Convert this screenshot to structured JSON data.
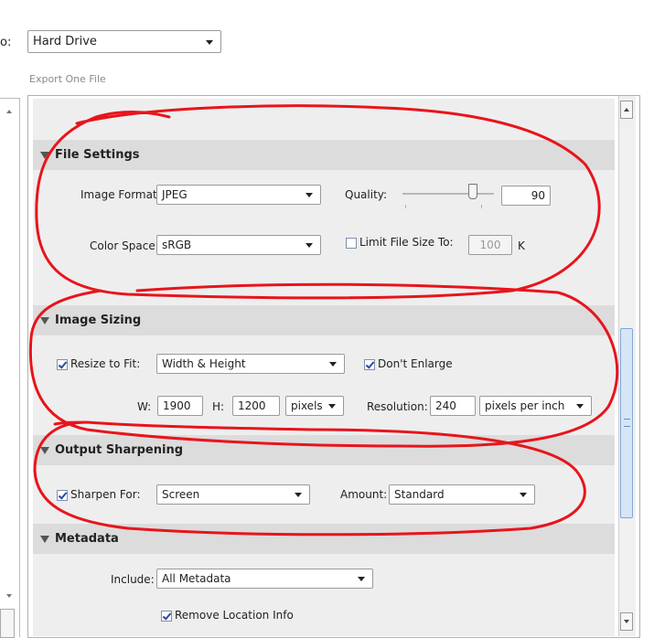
{
  "top": {
    "export_to_label": "o:",
    "destination": "Hard Drive",
    "subtitle": "Export One File"
  },
  "file_settings": {
    "title": "File Settings",
    "image_format_label": "Image Format:",
    "image_format_value": "JPEG",
    "quality_label": "Quality:",
    "quality_value": "90",
    "quality_level": 90,
    "color_space_label": "Color Space:",
    "color_space_value": "sRGB",
    "limit_size_label": "Limit File Size To:",
    "limit_size_value": "100",
    "limit_size_unit": "K",
    "limit_size_checked": false
  },
  "image_sizing": {
    "title": "Image Sizing",
    "resize_label": "Resize to Fit:",
    "resize_checked": true,
    "resize_mode": "Width & Height",
    "dont_enlarge_label": "Don't Enlarge",
    "dont_enlarge_checked": true,
    "w_label": "W:",
    "w_value": "1900",
    "h_label": "H:",
    "h_value": "1200",
    "unit_value": "pixels",
    "resolution_label": "Resolution:",
    "resolution_value": "240",
    "resolution_unit": "pixels per inch"
  },
  "output_sharpening": {
    "title": "Output Sharpening",
    "sharpen_label": "Sharpen For:",
    "sharpen_checked": true,
    "sharpen_value": "Screen",
    "amount_label": "Amount:",
    "amount_value": "Standard"
  },
  "metadata": {
    "title": "Metadata",
    "include_label": "Include:",
    "include_value": "All Metadata",
    "remove_location_label": "Remove Location Info",
    "remove_location_checked": true
  },
  "colors": {
    "annotation": "#e8141c",
    "section_header": "#dcdcdc",
    "panel": "#eeeeee"
  }
}
